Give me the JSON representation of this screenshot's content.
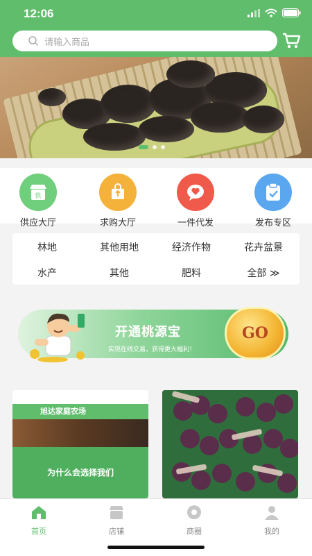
{
  "status_bar": {
    "time": "12:06"
  },
  "search": {
    "placeholder": "请输入商品"
  },
  "quick_links": [
    {
      "label": "供应大厅",
      "icon": "store-icon",
      "color": "#6fcf7c",
      "glyph": "供"
    },
    {
      "label": "求购大厅",
      "icon": "buy-bag-icon",
      "color": "#f5b23a",
      "glyph": "⬆"
    },
    {
      "label": "一件代发",
      "icon": "heart-chat-icon",
      "color": "#ef5a4a",
      "glyph": "♥"
    },
    {
      "label": "发布专区",
      "icon": "clipboard-check-icon",
      "color": "#5aa7ef",
      "glyph": "✓"
    }
  ],
  "categories": [
    {
      "label": "林地"
    },
    {
      "label": "其他用地"
    },
    {
      "label": "经济作物"
    },
    {
      "label": "花卉盆景"
    },
    {
      "label": "水产"
    },
    {
      "label": "其他"
    },
    {
      "label": "肥料"
    },
    {
      "label": "全部 ≫"
    }
  ],
  "promo": {
    "title": "开通桃源宝",
    "subtitle": "实现在线交易，获得更大福利！",
    "go_label": "GO"
  },
  "product_cards": [
    {
      "line1": "旭达家庭农场",
      "line2": "为什么会选择我们"
    },
    {
      "line1": ""
    }
  ],
  "tabs": [
    {
      "label": "首页",
      "icon": "home-icon",
      "active": true
    },
    {
      "label": "店铺",
      "icon": "shop-icon",
      "active": false
    },
    {
      "label": "商圈",
      "icon": "circle-icon",
      "active": false
    },
    {
      "label": "我的",
      "icon": "user-icon",
      "active": false
    }
  ],
  "colors": {
    "primary": "#5fbd6c"
  }
}
